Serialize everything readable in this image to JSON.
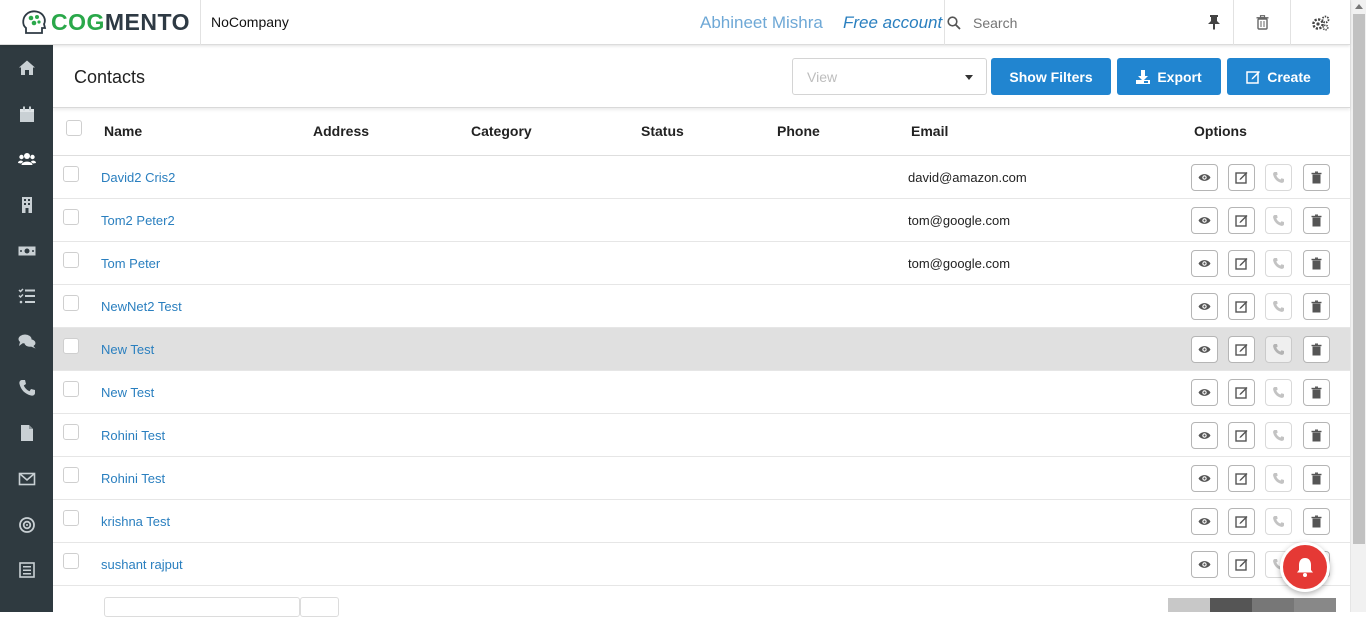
{
  "app": {
    "brand": "COGMENTO"
  },
  "topbar": {
    "company": "NoCompany",
    "user_name": "Abhineet Mishra",
    "account_type": "Free account",
    "search_placeholder": "Search"
  },
  "sidebar": {
    "icons": [
      "home-icon",
      "calendar-icon",
      "contacts-icon",
      "companies-icon",
      "deals-icon",
      "tasks-icon",
      "cases-icon",
      "calls-icon",
      "documents-icon",
      "email-icon",
      "campaigns-icon",
      "forms-icon"
    ]
  },
  "header": {
    "title": "Contacts",
    "view_placeholder": "View",
    "show_filters": "Show Filters",
    "export": "Export",
    "create": "Create"
  },
  "table": {
    "columns": [
      "Name",
      "Address",
      "Category",
      "Status",
      "Phone",
      "Email",
      "Options"
    ],
    "rows": [
      {
        "name": "David2 Cris2",
        "email": "david@amazon.com"
      },
      {
        "name": "Tom2 Peter2",
        "email": "tom@google.com"
      },
      {
        "name": "Tom Peter",
        "email": "tom@google.com"
      },
      {
        "name": "NewNet2 Test",
        "email": ""
      },
      {
        "name": "New Test",
        "email": ""
      },
      {
        "name": "New Test",
        "email": ""
      },
      {
        "name": "Rohini Test",
        "email": ""
      },
      {
        "name": "Rohini Test",
        "email": ""
      },
      {
        "name": "krishna Test",
        "email": ""
      },
      {
        "name": "sushant rajput",
        "email": ""
      }
    ]
  },
  "colors": {
    "primary": "#2185d0",
    "sidebar": "#2f3a40",
    "link": "#2a7fbf",
    "highlight_row": "#e0e0e0",
    "notification": "#e53935"
  }
}
